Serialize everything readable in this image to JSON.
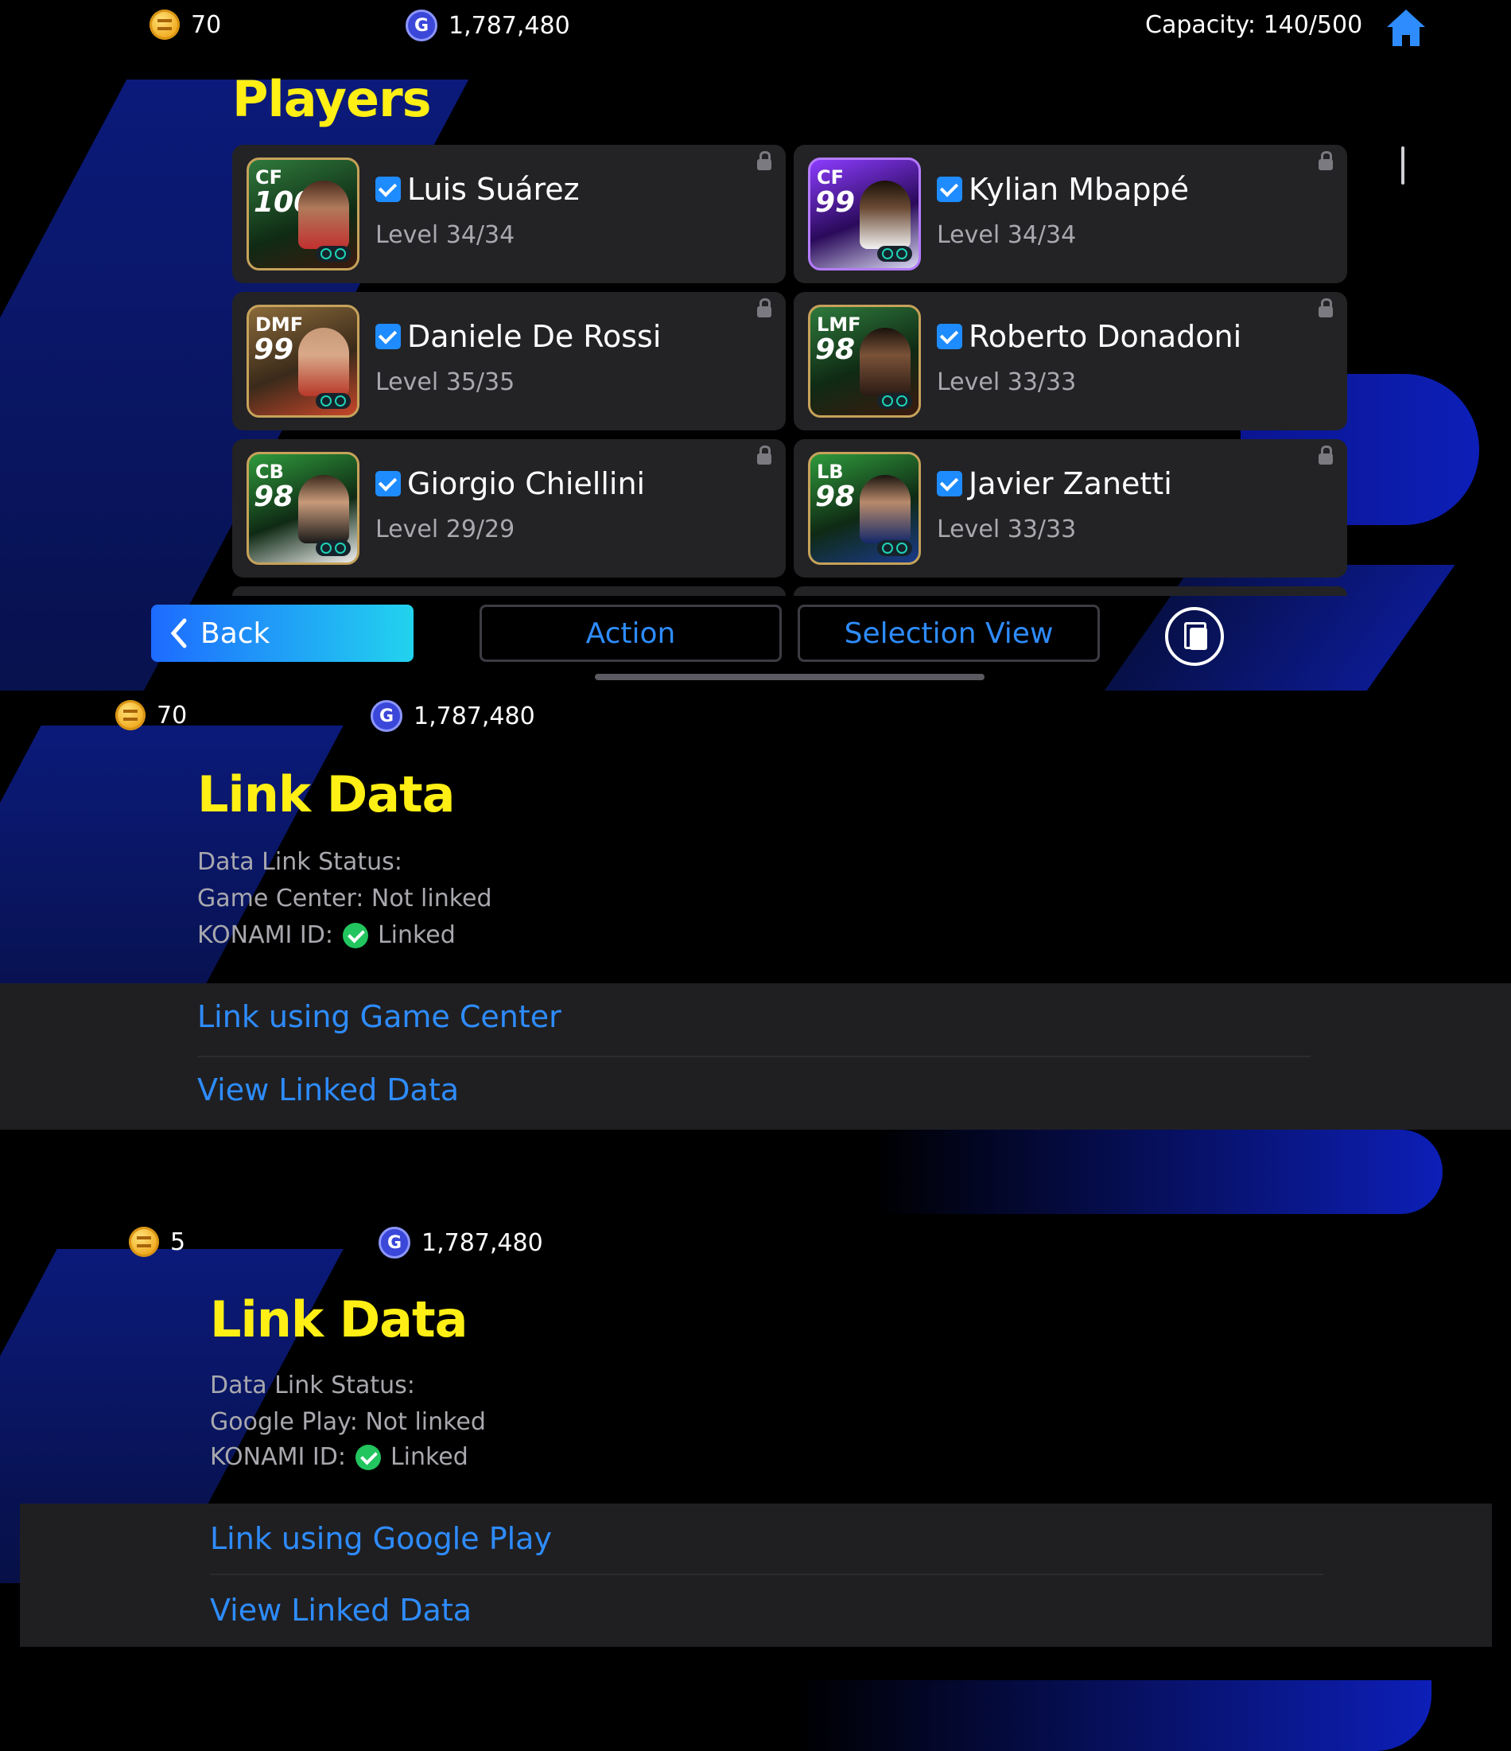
{
  "screen1": {
    "coins": "70",
    "gp": "1,787,480",
    "capacity": "Capacity: 140/500",
    "title": "Players",
    "players": [
      {
        "position": "CF",
        "rating": "100",
        "name": "Luis Suárez",
        "level": "Level 34/34"
      },
      {
        "position": "CF",
        "rating": "99",
        "name": "Kylian Mbappé",
        "level": "Level 34/34"
      },
      {
        "position": "DMF",
        "rating": "99",
        "name": "Daniele De Rossi",
        "level": "Level 35/35"
      },
      {
        "position": "LMF",
        "rating": "98",
        "name": "Roberto Donadoni",
        "level": "Level 33/33"
      },
      {
        "position": "CB",
        "rating": "98",
        "name": "Giorgio Chiellini",
        "level": "Level 29/29"
      },
      {
        "position": "LB",
        "rating": "98",
        "name": "Javier Zanetti",
        "level": "Level 33/33"
      }
    ],
    "buttons": {
      "back": "Back",
      "action": "Action",
      "selection_view": "Selection View"
    },
    "icons": [
      "coin-icon",
      "gp-icon",
      "home-icon",
      "lock-icon",
      "verified-check-icon",
      "chevron-left-icon",
      "copy-icon"
    ],
    "colors": {
      "title": "#ffef14",
      "accent": "#2e8cff",
      "back_gradient": [
        "#1e6bff",
        "#22d3ee"
      ]
    }
  },
  "screen2": {
    "coins": "70",
    "gp": "1,787,480",
    "title": "Link Data",
    "status_header": "Data Link Status:",
    "service_status": "Game Center: Not linked",
    "konami_label": "KONAMI ID:",
    "konami_status": "Linked",
    "menu": [
      "Link using Game Center",
      "View Linked Data"
    ]
  },
  "screen3": {
    "coins": "5",
    "gp": "1,787,480",
    "title": "Link Data",
    "status_header": "Data Link Status:",
    "service_status": "Google Play: Not linked",
    "konami_label": "KONAMI ID:",
    "konami_status": "Linked",
    "menu": [
      "Link using Google Play",
      "View Linked Data"
    ]
  }
}
